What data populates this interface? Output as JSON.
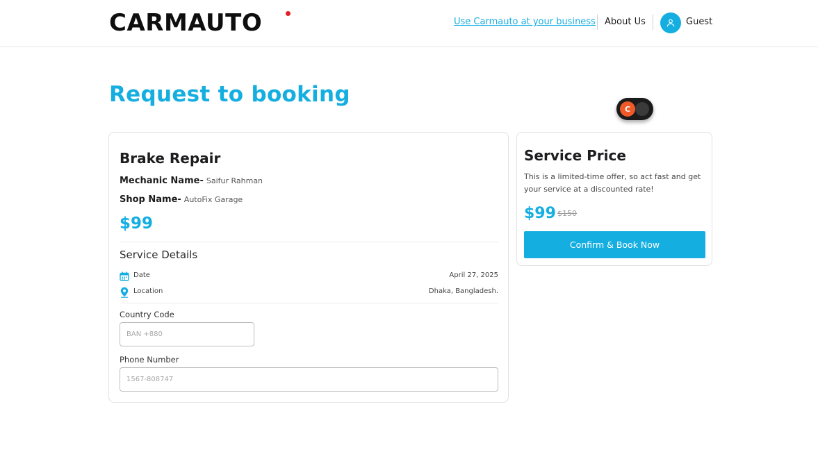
{
  "header": {
    "logo": "CARMAUTO",
    "business_link": "Use Carmauto at your business",
    "about_link": "About Us",
    "user_name": "Guest"
  },
  "page": {
    "title": "Request to booking"
  },
  "floating_badge": {
    "letter": "C"
  },
  "booking": {
    "service_name": "Brake Repair",
    "mechanic_label": "Mechanic Name-",
    "mechanic_value": "Saifur Rahman",
    "shop_label": "Shop Name-",
    "shop_value": "AutoFix Garage",
    "price": "$99",
    "details_title": "Service Details",
    "date_label": "Date",
    "date_value": "April 27, 2025",
    "location_label": "Location",
    "location_value": "Dhaka, Bangladesh.",
    "country_code_label": "Country Code",
    "country_code_placeholder": "BAN +880",
    "phone_label": "Phone Number",
    "phone_placeholder": "1567-808747"
  },
  "price_card": {
    "title": "Service Price",
    "description": "This is a limited-time offer, so act fast and get your service at a discounted rate!",
    "current_price": "$99",
    "old_price": "$150",
    "confirm_button": "Confirm & Book Now"
  },
  "colors": {
    "accent": "#15aee1",
    "logo_dot": "#e41e26",
    "badge": "#f05a28"
  },
  "icons": {
    "avatar": "user-icon",
    "date": "calendar-icon",
    "location": "map-pin-icon"
  }
}
